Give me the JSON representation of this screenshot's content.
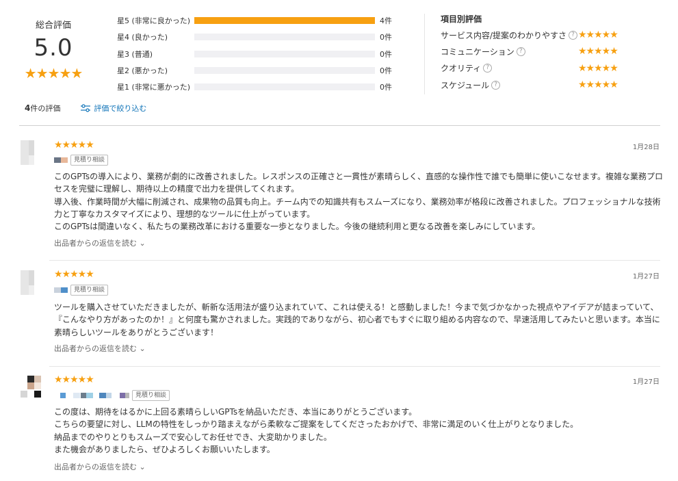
{
  "summary": {
    "overall_label": "総合評価",
    "overall_score": "5.0",
    "overall_stars": "★★★★★",
    "rating_fraction": 1.0,
    "distribution": [
      {
        "label": "星5 (非常に良かった)",
        "count": "4件",
        "fraction": 1.0
      },
      {
        "label": "星4 (良かった)",
        "count": "0件",
        "fraction": 0
      },
      {
        "label": "星3 (普通)",
        "count": "0件",
        "fraction": 0
      },
      {
        "label": "星2 (悪かった)",
        "count": "0件",
        "fraction": 0
      },
      {
        "label": "星1 (非常に悪かった)",
        "count": "0件",
        "fraction": 0
      }
    ],
    "categories_title": "項目別評価",
    "categories": [
      {
        "label": "サービス内容/提案のわかりやすさ",
        "stars": "★★★★★"
      },
      {
        "label": "コミュニケーション",
        "stars": "★★★★★"
      },
      {
        "label": "クオリティ",
        "stars": "★★★★★"
      },
      {
        "label": "スケジュール",
        "stars": "★★★★★"
      }
    ],
    "help_icon": "?",
    "review_count_num": "4",
    "review_count_suffix": "件の評価",
    "filter_label": "評価で絞り込む"
  },
  "colors": {
    "accent": "#f7a011",
    "link": "#0f73b8"
  },
  "reviews": [
    {
      "stars": "★★★★★",
      "date": "1月28日",
      "badge": "見積り相談",
      "text": "このGPTsの導入により、業務が劇的に改善されました。レスポンスの正確さと一貫性が素晴らしく、直感的な操作性で誰でも簡単に使いこなせます。複雑な業務プロセスを完璧に理解し、期待以上の精度で出力を提供してくれます。\n導入後、作業時間が大幅に削減され、成果物の品質も向上。チーム内での知識共有もスムーズになり、業務効率が格段に改善されました。プロフェッショナルな技術力と丁寧なカスタマイズにより、理想的なツールに仕上がっています。\nこのGPTsは間違いなく、私たちの業務改革における重要な一歩となりました。今後の継続利用と更なる改善を楽しみにしています。",
      "reply": "出品者からの返信を読む ⌄"
    },
    {
      "stars": "★★★★★",
      "date": "1月27日",
      "badge": "見積り相談",
      "text": "ツールを購入させていただきましたが、斬新な活用法が盛り込まれていて、これは使える！と感動しました！今まで気づかなかった視点やアイデアが詰まっていて、『こんなやり方があったのか！』と何度も驚かされました。実践的でありながら、初心者でもすぐに取り組める内容なので、早速活用してみたいと思います。本当に素晴らしいツールをありがとうございます！",
      "reply": "出品者からの返信を読む ⌄"
    },
    {
      "stars": "★★★★★",
      "date": "1月27日",
      "badge": "見積り相談",
      "text": "この度は、期待をはるかに上回る素晴らしいGPTsを納品いただき、本当にありがとうございます。\nこちらの要望に対し、LLMの特性をしっかり踏まえながら柔軟なご提案をしてくださったおかげで、非常に満足のいく仕上がりとなりました。\n納品までのやりとりもスムーズで安心してお任せでき、大変助かりました。\nまた機会がありましたら、ぜひよろしくお願いいたします。",
      "reply": "出品者からの返信を読む ⌄"
    }
  ]
}
